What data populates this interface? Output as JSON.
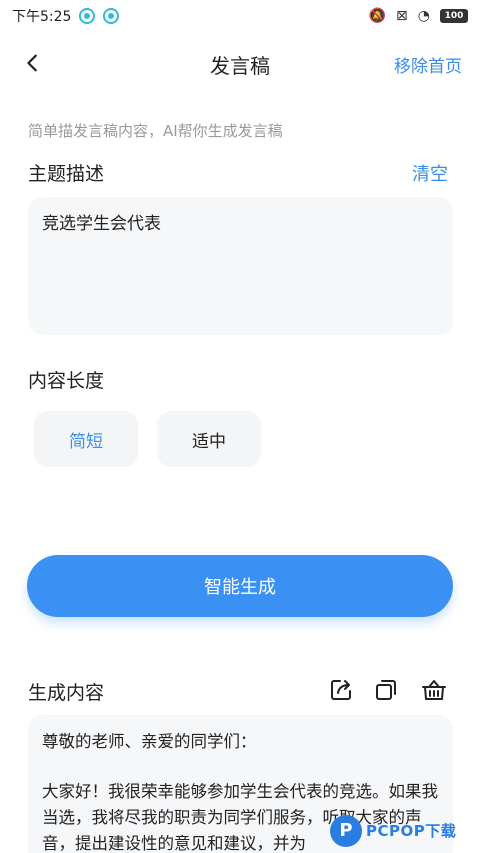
{
  "statusbar": {
    "time": "下午5:25",
    "battery": "100"
  },
  "nav": {
    "title": "发言稿",
    "action": "移除首页"
  },
  "hint": "简单描发言稿内容，AI帮你生成发言稿",
  "topic": {
    "label": "主题描述",
    "clear": "清空",
    "value": "竞选学生会代表"
  },
  "length": {
    "label": "内容长度",
    "options": [
      "简短",
      "适中"
    ],
    "selected": "简短"
  },
  "generate_label": "智能生成",
  "result": {
    "label": "生成内容",
    "greeting": "尊敬的老师、亲爱的同学们：",
    "body": "大家好！我很荣幸能够参加学生会代表的竞选。如果我当选，我将尽我的职责为同学们服务，听取大家的声音，提出建设性的意见和建议，并为"
  },
  "watermark": {
    "logo": "P",
    "text": "PCPOP下载"
  },
  "colors": {
    "accent": "#3a8ee6",
    "button": "#3b90f4",
    "field_bg": "#f6f7f9"
  }
}
